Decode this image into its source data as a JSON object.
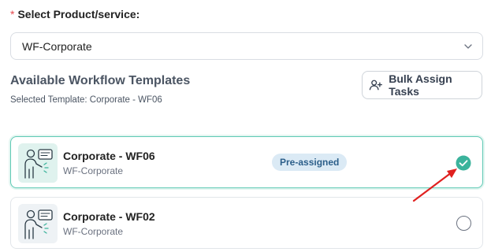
{
  "product_field": {
    "required_mark": "*",
    "label": "Select Product/service:",
    "value": "WF-Corporate"
  },
  "templates_section": {
    "title": "Available Workflow Templates",
    "selected_text": "Selected Template: Corporate - WF06",
    "bulk_button_label": "Bulk Assign Tasks"
  },
  "templates": [
    {
      "name": "Corporate - WF06",
      "product": "WF-Corporate",
      "badge": "Pre-assigned",
      "selected": true
    },
    {
      "name": "Corporate - WF02",
      "product": "WF-Corporate",
      "selected": false
    }
  ],
  "colors": {
    "accent": "#3bb39c",
    "required": "#e5484d",
    "annotation_arrow": "#e0201f"
  }
}
